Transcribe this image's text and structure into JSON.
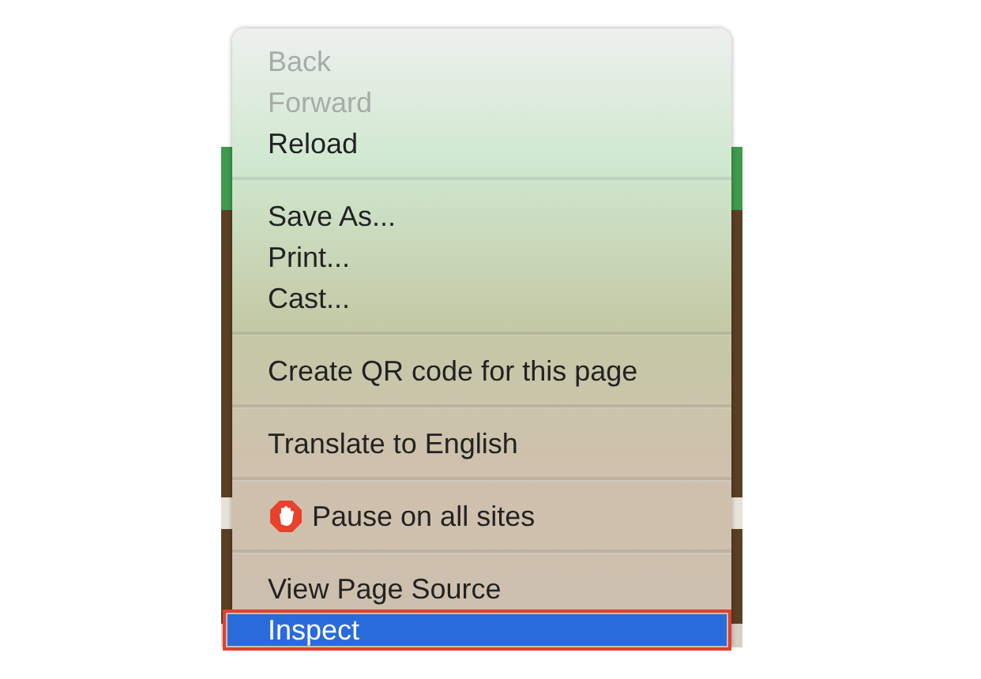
{
  "context_menu": {
    "items": [
      {
        "kind": "item",
        "label": "Back",
        "disabled": true,
        "selected": false
      },
      {
        "kind": "item",
        "label": "Forward",
        "disabled": true,
        "selected": false
      },
      {
        "kind": "item",
        "label": "Reload",
        "disabled": false,
        "selected": false
      },
      {
        "kind": "separator"
      },
      {
        "kind": "item",
        "label": "Save As...",
        "disabled": false,
        "selected": false
      },
      {
        "kind": "item",
        "label": "Print...",
        "disabled": false,
        "selected": false
      },
      {
        "kind": "item",
        "label": "Cast...",
        "disabled": false,
        "selected": false
      },
      {
        "kind": "separator"
      },
      {
        "kind": "item",
        "label": "Create QR code for this page",
        "disabled": false,
        "selected": false
      },
      {
        "kind": "separator"
      },
      {
        "kind": "item",
        "label": "Translate to English",
        "disabled": false,
        "selected": false
      },
      {
        "kind": "separator"
      },
      {
        "kind": "icon-item",
        "label": "Pause on all sites",
        "disabled": false,
        "selected": false
      },
      {
        "kind": "separator"
      },
      {
        "kind": "item",
        "label": "View Page Source",
        "disabled": false,
        "selected": false
      },
      {
        "kind": "item",
        "label": "Inspect",
        "disabled": false,
        "selected": true,
        "outlined": true
      }
    ]
  }
}
